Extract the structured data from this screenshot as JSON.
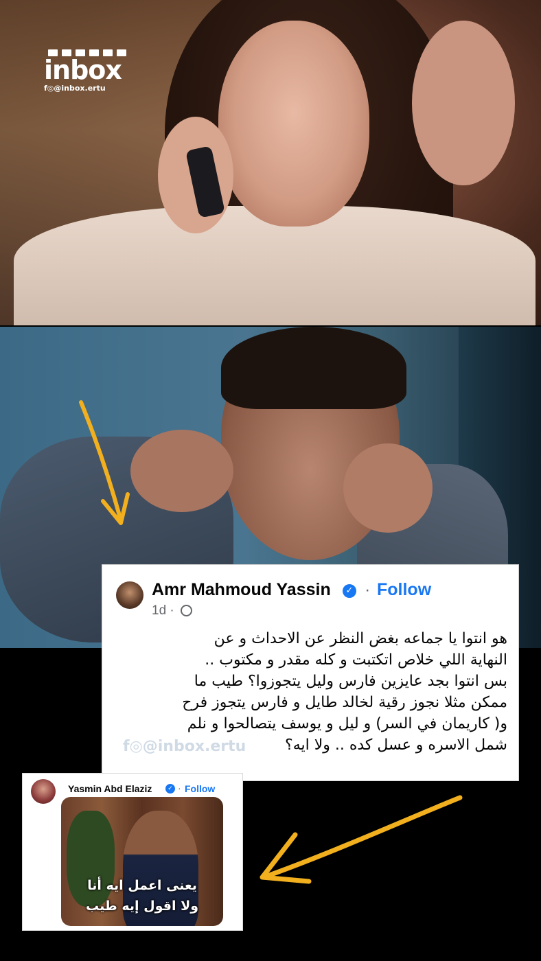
{
  "logo": {
    "word": "inbox",
    "handle": "f◎@inbox.ertu"
  },
  "post": {
    "author": "Amr Mahmoud Yassin",
    "separator": "·",
    "follow_label": "Follow",
    "time": "1d",
    "meta_separator": "·",
    "lines": [
      "هو انتوا يا جماعه بغض النظر عن الاحداث و عن",
      "النهاية اللي خلاص اتكتبت و كله مقدر و مكتوب ..",
      "بس انتوا بجد عايزين فارس وليل يتجوزوا؟ طيب ما",
      "ممكن مثلا نجوز رقية لخالد طايل و فارس يتجوز فرح",
      "و( كاريمان في السر) و ليل و يوسف يتصالحوا و نلم",
      "شمل الاسره و عسل كده .. ولا ايه؟"
    ],
    "watermark": "f◎@inbox.ertu"
  },
  "reply": {
    "author": "Yasmin Abd Elaziz",
    "separator": "·",
    "follow_label": "Follow",
    "meme_caption": [
      "يعنى اعمل ايه أنا",
      "ولا اقول إيه طيب"
    ]
  },
  "colors": {
    "facebook_blue": "#1877f2",
    "arrow_yellow": "#f2b01e"
  }
}
